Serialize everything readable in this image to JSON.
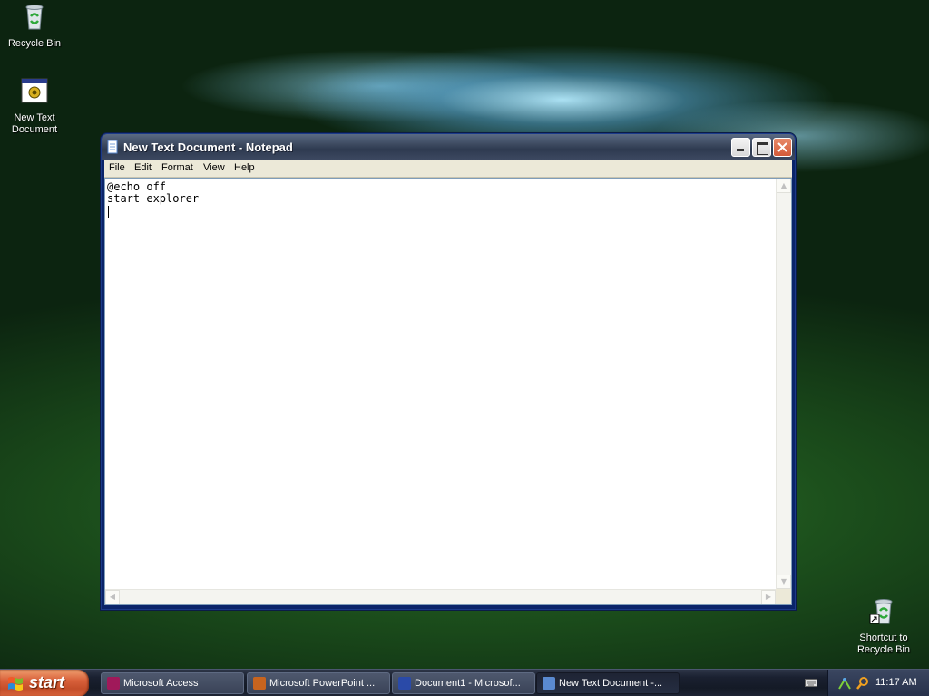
{
  "desktop": {
    "icons": [
      {
        "label": "Recycle Bin",
        "icon": "recycle-bin-icon"
      },
      {
        "label": "New Text Document",
        "icon": "batch-file-icon"
      },
      {
        "label": "Shortcut to Recycle Bin",
        "icon": "recycle-bin-shortcut-icon"
      }
    ]
  },
  "window": {
    "title": "New Text Document - Notepad",
    "icon": "notepad-icon",
    "menu": [
      "File",
      "Edit",
      "Format",
      "View",
      "Help"
    ],
    "content_lines": [
      "@echo off",
      "start explorer"
    ]
  },
  "taskbar": {
    "start_label": "start",
    "tasks": [
      {
        "label": "Microsoft Access",
        "icon": "access-icon",
        "color": "#a0195a"
      },
      {
        "label": "Microsoft PowerPoint ...",
        "icon": "powerpoint-icon",
        "color": "#c8641e"
      },
      {
        "label": "Document1 - Microsof...",
        "icon": "word-icon",
        "color": "#2a4aa8"
      },
      {
        "label": "New Text Document -...",
        "icon": "notepad-icon",
        "color": "#5a8ad0"
      }
    ],
    "clock": "11:17 AM"
  }
}
